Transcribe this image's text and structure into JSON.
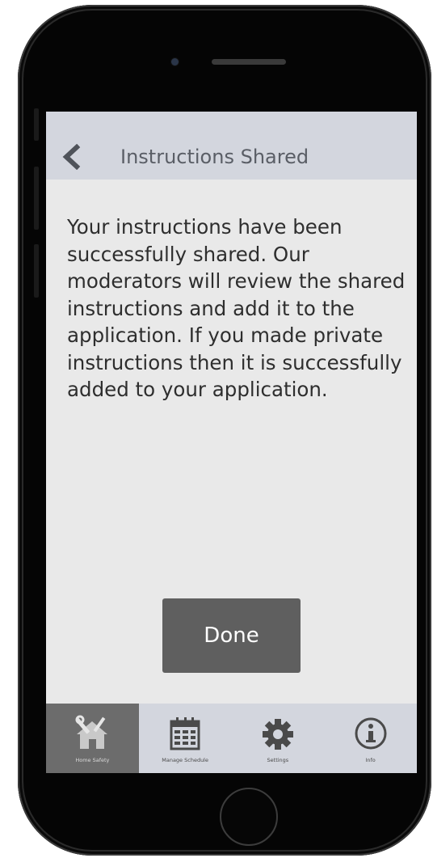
{
  "header": {
    "title": "Instructions Shared"
  },
  "main": {
    "message": "Your instructions have been successfully shared. Our moderators will review the shared instructions and add it to the application. If you made private instructions then it is successfully added to your application.",
    "done_label": "Done"
  },
  "tabbar": {
    "tabs": [
      {
        "label": "Home Safety",
        "icon": "home-tools-icon",
        "active": true
      },
      {
        "label": "Manage Schedule",
        "icon": "calendar-icon",
        "active": false
      },
      {
        "label": "Settings",
        "icon": "gear-icon",
        "active": false
      },
      {
        "label": "Info",
        "icon": "info-icon",
        "active": false
      }
    ]
  },
  "colors": {
    "header_bg": "#d3d6de",
    "screen_bg": "#e9e9e9",
    "button_bg": "#5f5f5f",
    "active_tab_bg": "#6c6c6c",
    "phone_body": "#050505"
  }
}
